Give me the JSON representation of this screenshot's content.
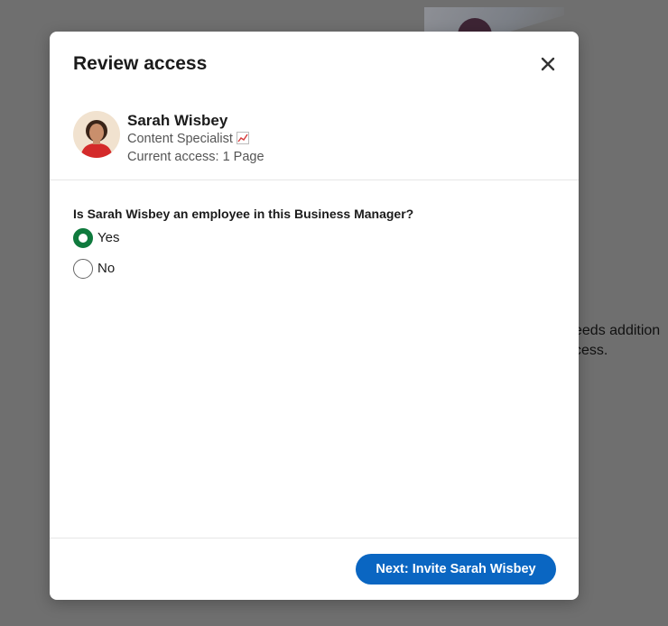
{
  "background": {
    "text_line1": "eeds addition",
    "text_line2": "cess."
  },
  "modal": {
    "title": "Review access",
    "close_icon": "close-icon",
    "profile": {
      "name": "Sarah Wisbey",
      "role": "Content Specialist",
      "role_icon": "chart-increasing-icon",
      "access": "Current access: 1 Page"
    },
    "question": "Is Sarah Wisbey an employee in this Business Manager?",
    "options": [
      {
        "label": "Yes",
        "checked": true
      },
      {
        "label": "No",
        "checked": false
      }
    ],
    "next_button": "Next: Invite Sarah Wisbey"
  },
  "colors": {
    "primary_button": "#0a66c2",
    "radio_checked": "#0f7a3d"
  }
}
